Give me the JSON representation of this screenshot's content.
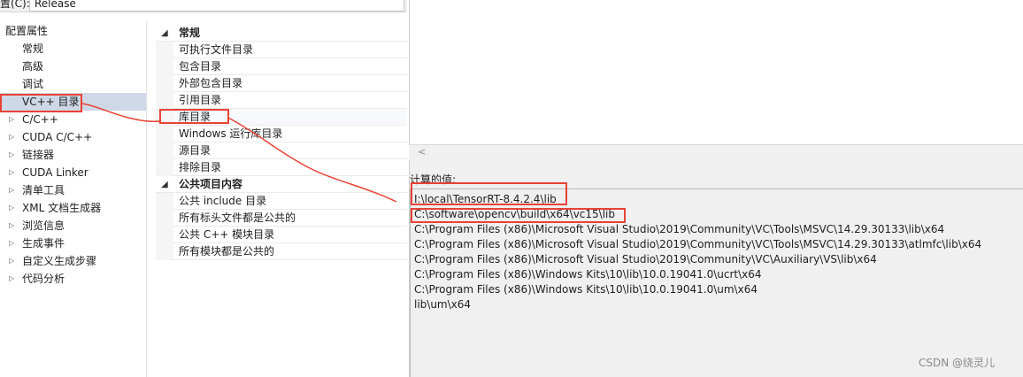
{
  "config": {
    "label": "置(C):",
    "value": "Release"
  },
  "tree": {
    "items": [
      {
        "label": "配置属性",
        "expand": ""
      },
      {
        "label": "常规",
        "expand": ""
      },
      {
        "label": "高级",
        "expand": ""
      },
      {
        "label": "调试",
        "expand": ""
      },
      {
        "label": "VC++ 目录",
        "expand": ""
      },
      {
        "label": "C/C++",
        "expand": "▷"
      },
      {
        "label": "CUDA C/C++",
        "expand": "▷"
      },
      {
        "label": "链接器",
        "expand": "▷"
      },
      {
        "label": "CUDA Linker",
        "expand": "▷"
      },
      {
        "label": "清单工具",
        "expand": "▷"
      },
      {
        "label": "XML 文档生成器",
        "expand": "▷"
      },
      {
        "label": "浏览信息",
        "expand": "▷"
      },
      {
        "label": "生成事件",
        "expand": "▷"
      },
      {
        "label": "自定义生成步骤",
        "expand": "▷"
      },
      {
        "label": "代码分析",
        "expand": "▷"
      }
    ]
  },
  "grid": {
    "collapse_glyph": "◢",
    "rows": [
      {
        "label": "常规",
        "category": true
      },
      {
        "label": "可执行文件目录",
        "category": false
      },
      {
        "label": "包含目录",
        "category": false
      },
      {
        "label": "外部包含目录",
        "category": false
      },
      {
        "label": "引用目录",
        "category": false
      },
      {
        "label": "库目录",
        "category": false
      },
      {
        "label": "Windows 运行库目录",
        "category": false
      },
      {
        "label": "源目录",
        "category": false
      },
      {
        "label": "排除目录",
        "category": false
      },
      {
        "label": "公共项目内容",
        "category": true
      },
      {
        "label": "公共 include 目录",
        "category": false
      },
      {
        "label": "所有标头文件都是公共的",
        "category": false
      },
      {
        "label": "公共 C++ 模块目录",
        "category": false
      },
      {
        "label": "所有模块都是公共的",
        "category": false
      }
    ]
  },
  "scrollbar": {
    "left_arrow": "<"
  },
  "values": {
    "label": "计算的值:",
    "lines": [
      "I:\\local\\TensorRT-8.4.2.4\\lib",
      "C:\\software\\opencv\\build\\x64\\vc15\\lib",
      "C:\\Program Files (x86)\\Microsoft Visual Studio\\2019\\Community\\VC\\Tools\\MSVC\\14.29.30133\\lib\\x64",
      "C:\\Program Files (x86)\\Microsoft Visual Studio\\2019\\Community\\VC\\Tools\\MSVC\\14.29.30133\\atlmfc\\lib\\x64",
      "C:\\Program Files (x86)\\Microsoft Visual Studio\\2019\\Community\\VC\\Auxiliary\\VS\\lib\\x64",
      "C:\\Program Files (x86)\\Windows Kits\\10\\lib\\10.0.19041.0\\ucrt\\x64",
      "C:\\Program Files (x86)\\Windows Kits\\10\\lib\\10.0.19041.0\\um\\x64",
      "lib\\um\\x64"
    ]
  },
  "watermark": "CSDN @绕灵儿",
  "colors": {
    "annotation": "#e84235",
    "selection": "#cfd8e6"
  }
}
